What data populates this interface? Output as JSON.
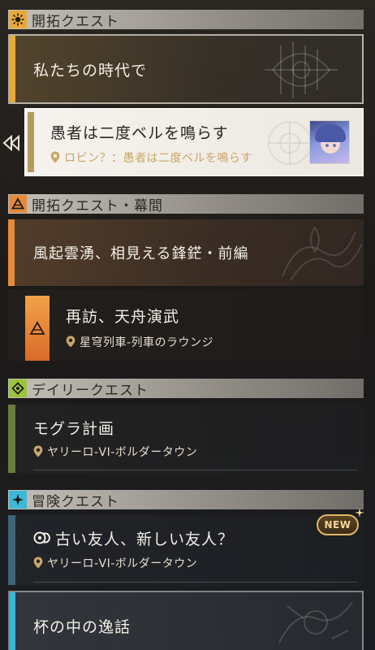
{
  "sections": {
    "trailblaze": {
      "title": "開拓クエスト",
      "icon": "sun-emblem-icon",
      "color": "#e8a93a"
    },
    "interlude": {
      "title": "開拓クエスト・幕間",
      "icon": "triangle-emblem-icon",
      "color": "#e58a3c"
    },
    "daily": {
      "title": "デイリークエスト",
      "icon": "diamond-emblem-icon",
      "color": "#9bc43a"
    },
    "adventure": {
      "title": "冒険クエスト",
      "icon": "star-emblem-icon",
      "color": "#3cb8d8"
    }
  },
  "quests": {
    "q1": {
      "title": "私たちの時代で"
    },
    "q2": {
      "title": "愚者は二度ベルを鳴らす",
      "location": "ロビン？：愚者は二度ベルを鳴らす"
    },
    "q3": {
      "title": "風起雲湧、相見える鋒鋩・前編"
    },
    "q4": {
      "title": "再訪、天舟演武",
      "location": "星穹列車-列車のラウンジ"
    },
    "q5": {
      "title": "モグラ計画",
      "location": "ヤリーロ-VI-ボルダータウン"
    },
    "q6": {
      "title": "古い友人、新しい友人？",
      "location": "ヤリーロ-VI-ボルダータウン",
      "badge": "NEW"
    },
    "q7": {
      "title": "杯の中の逸話"
    }
  }
}
